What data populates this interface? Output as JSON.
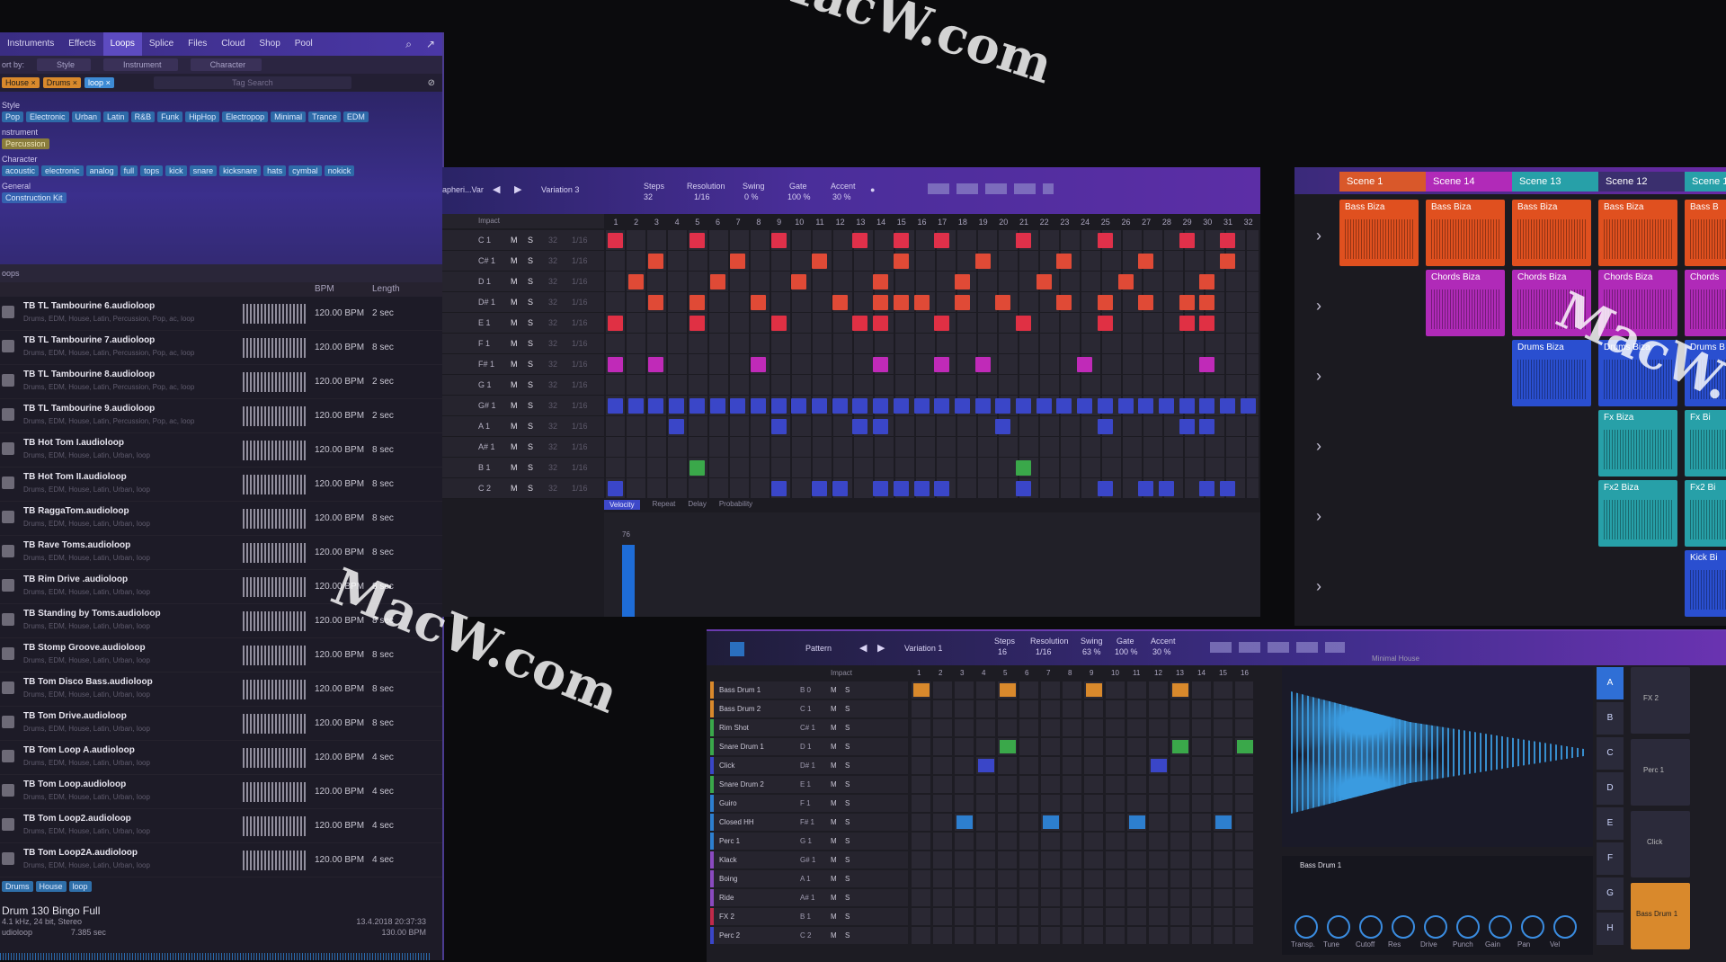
{
  "browser": {
    "tabs": [
      "Instruments",
      "Effects",
      "Loops",
      "Splice",
      "Files",
      "Cloud",
      "Shop",
      "Pool"
    ],
    "active_tab": "Loops",
    "sort_label": "ort by:",
    "sort_options": [
      "Style",
      "Instrument",
      "Character"
    ],
    "active_chips": [
      "House ×",
      "Drums ×",
      "loop ×"
    ],
    "tag_search_placeholder": "Tag Search",
    "filter_groups": [
      {
        "label": "Style",
        "tags": [
          "Pop",
          "Electronic",
          "Urban",
          "Latin",
          "R&B",
          "Funk",
          "HipHop",
          "Electropop",
          "Minimal",
          "Trance",
          "EDM"
        ]
      },
      {
        "label": "nstrument",
        "tags": [
          "Percussion"
        ]
      },
      {
        "label": "Character",
        "tags": [
          "acoustic",
          "electronic",
          "analog",
          "full",
          "tops",
          "kick",
          "snare",
          "kicksnare",
          "hats",
          "cymbal",
          "nokick"
        ]
      },
      {
        "label": "General",
        "tags": [
          "Construction Kit"
        ]
      }
    ],
    "loops_header": "oops",
    "columns": {
      "bpm": "BPM",
      "length": "Length"
    },
    "loops": [
      {
        "name": "TB TL Tambourine 6.audioloop",
        "sub": "Drums, EDM, House, Latin, Percussion, Pop, ac, loop",
        "bpm": "120.00 BPM",
        "len": "2 sec"
      },
      {
        "name": "TB TL Tambourine 7.audioloop",
        "sub": "Drums, EDM, House, Latin, Percussion, Pop, ac, loop",
        "bpm": "120.00 BPM",
        "len": "8 sec"
      },
      {
        "name": "TB TL Tambourine 8.audioloop",
        "sub": "Drums, EDM, House, Latin, Percussion, Pop, ac, loop",
        "bpm": "120.00 BPM",
        "len": "2 sec"
      },
      {
        "name": "TB TL Tambourine 9.audioloop",
        "sub": "Drums, EDM, House, Latin, Percussion, Pop, ac, loop",
        "bpm": "120.00 BPM",
        "len": "2 sec"
      },
      {
        "name": "TB Hot Tom I.audioloop",
        "sub": "Drums, EDM, House, Latin, Urban, loop",
        "bpm": "120.00 BPM",
        "len": "8 sec"
      },
      {
        "name": "TB Hot Tom II.audioloop",
        "sub": "Drums, EDM, House, Latin, Urban, loop",
        "bpm": "120.00 BPM",
        "len": "8 sec"
      },
      {
        "name": "TB RaggaTom.audioloop",
        "sub": "Drums, EDM, House, Latin, Urban, loop",
        "bpm": "120.00 BPM",
        "len": "8 sec"
      },
      {
        "name": "TB Rave Toms.audioloop",
        "sub": "Drums, EDM, House, Latin, Urban, loop",
        "bpm": "120.00 BPM",
        "len": "8 sec"
      },
      {
        "name": "TB Rim Drive .audioloop",
        "sub": "Drums, EDM, House, Latin, Urban, loop",
        "bpm": "120.00 BPM",
        "len": "8 sec"
      },
      {
        "name": "TB Standing by Toms.audioloop",
        "sub": "Drums, EDM, House, Latin, Urban, loop",
        "bpm": "120.00 BPM",
        "len": "8 sec"
      },
      {
        "name": "TB Stomp Groove.audioloop",
        "sub": "Drums, EDM, House, Latin, Urban, loop",
        "bpm": "120.00 BPM",
        "len": "8 sec"
      },
      {
        "name": "TB Tom Disco Bass.audioloop",
        "sub": "Drums, EDM, House, Latin, Urban, loop",
        "bpm": "120.00 BPM",
        "len": "8 sec"
      },
      {
        "name": "TB Tom Drive.audioloop",
        "sub": "Drums, EDM, House, Latin, Urban, loop",
        "bpm": "120.00 BPM",
        "len": "8 sec"
      },
      {
        "name": "TB Tom Loop A.audioloop",
        "sub": "Drums, EDM, House, Latin, Urban, loop",
        "bpm": "120.00 BPM",
        "len": "4 sec"
      },
      {
        "name": "TB Tom Loop.audioloop",
        "sub": "Drums, EDM, House, Latin, Urban, loop",
        "bpm": "120.00 BPM",
        "len": "4 sec"
      },
      {
        "name": "TB Tom Loop2.audioloop",
        "sub": "Drums, EDM, House, Latin, Urban, loop",
        "bpm": "120.00 BPM",
        "len": "4 sec"
      },
      {
        "name": "TB Tom Loop2A.audioloop",
        "sub": "Drums, EDM, House, Latin, Urban, loop",
        "bpm": "120.00 BPM",
        "len": "4 sec"
      }
    ],
    "bottom_tags": [
      "Drums",
      "House",
      "loop"
    ],
    "preview": {
      "title": "Drum 130 Bingo Full",
      "format": "4.1 kHz, 24 bit, Stereo",
      "type": "udioloop",
      "duration": "7.385 sec",
      "date": "13.4.2018 20:37:33",
      "bpm": "130.00 BPM"
    }
  },
  "pattern": {
    "name": "apheri...Var",
    "variation": "Variation 3",
    "params": [
      {
        "label": "Steps",
        "value": "32"
      },
      {
        "label": "Resolution",
        "value": "1/16"
      },
      {
        "label": "Swing",
        "value": "0 %"
      },
      {
        "label": "Gate",
        "value": "100 %"
      },
      {
        "label": "Accent",
        "value": "30 %"
      }
    ],
    "instrument": "Impact",
    "lanes": [
      {
        "note": "C 1",
        "steps": "32",
        "res": "1/16"
      },
      {
        "note": "C# 1",
        "steps": "32",
        "res": "1/16"
      },
      {
        "note": "D 1",
        "steps": "32",
        "res": "1/16"
      },
      {
        "note": "D# 1",
        "steps": "32",
        "res": "1/16"
      },
      {
        "note": "E 1",
        "steps": "32",
        "res": "1/16"
      },
      {
        "note": "F 1",
        "steps": "32",
        "res": "1/16"
      },
      {
        "note": "F# 1",
        "steps": "32",
        "res": "1/16"
      },
      {
        "note": "G 1",
        "steps": "32",
        "res": "1/16"
      },
      {
        "note": "G# 1",
        "steps": "32",
        "res": "1/16"
      },
      {
        "note": "A 1",
        "steps": "32",
        "res": "1/16"
      },
      {
        "note": "A# 1",
        "steps": "32",
        "res": "1/16"
      },
      {
        "note": "B 1",
        "steps": "32",
        "res": "1/16"
      },
      {
        "note": "C 2",
        "steps": "32",
        "res": "1/16"
      }
    ],
    "mute": "M",
    "solo": "S",
    "bottom_tabs": [
      "Velocity",
      "Repeat",
      "Delay",
      "Probability"
    ],
    "velocity_value": "76"
  },
  "scenes": {
    "headers": [
      "Scene 1",
      "Scene 14",
      "Scene 13",
      "Scene 12",
      "Scene 1"
    ],
    "clips": [
      "Bass Biza",
      "Bass Biza",
      "Bass Biza",
      "Bass Biza",
      "Bass B",
      "Chords Biza",
      "Chords Biza",
      "Chords Biza",
      "Chords",
      "Drums Biza",
      "Drums Biza",
      "Drums B",
      "Fx Biza",
      "Fx Bi",
      "Fx2 Biza",
      "Fx2 Bi",
      "Kick Bi"
    ],
    "colors": {
      "bass": "#e0501f",
      "chords": "#b02ab8",
      "drums": "#2a4fd0",
      "fx": "#27a0a8",
      "scene_head": "#d9582a"
    }
  },
  "pattern2": {
    "name": "Pattern",
    "variation": "Variation 1",
    "params": [
      {
        "label": "Steps",
        "value": "16"
      },
      {
        "label": "Resolution",
        "value": "1/16"
      },
      {
        "label": "Swing",
        "value": "63 %"
      },
      {
        "label": "Gate",
        "value": "100 %"
      },
      {
        "label": "Accent",
        "value": "30 %"
      }
    ],
    "instrument": "Impact",
    "lanes": [
      {
        "name": "Bass Drum 1",
        "key": "B 0"
      },
      {
        "name": "Bass Drum 2",
        "key": "C 1"
      },
      {
        "name": "Rim Shot",
        "key": "C# 1"
      },
      {
        "name": "Snare Drum 1",
        "key": "D 1"
      },
      {
        "name": "Click",
        "key": "D# 1"
      },
      {
        "name": "Snare Drum 2",
        "key": "E 1"
      },
      {
        "name": "Guiro",
        "key": "F 1"
      },
      {
        "name": "Closed HH",
        "key": "F# 1"
      },
      {
        "name": "Perc 1",
        "key": "G 1"
      },
      {
        "name": "Klack",
        "key": "G# 1"
      },
      {
        "name": "Boing",
        "key": "A 1"
      },
      {
        "name": "Ride",
        "key": "A# 1"
      },
      {
        "name": "FX 2",
        "key": "B 1"
      },
      {
        "name": "Perc 2",
        "key": "C 2"
      }
    ],
    "preset": "Minimal House",
    "sample_name": "Bass Drum 1",
    "pad_rows": [
      "A",
      "B",
      "C",
      "D",
      "E",
      "F",
      "G",
      "H"
    ],
    "pads": [
      "FX 2",
      "Perc 1",
      "Click",
      "Bass Drum 1"
    ],
    "knobs": [
      "Transp.",
      "Tune",
      "Cutoff",
      "Res",
      "Drive",
      "Punch",
      "Gain",
      "Pan",
      "Vel"
    ]
  },
  "watermark": "MacW.com"
}
